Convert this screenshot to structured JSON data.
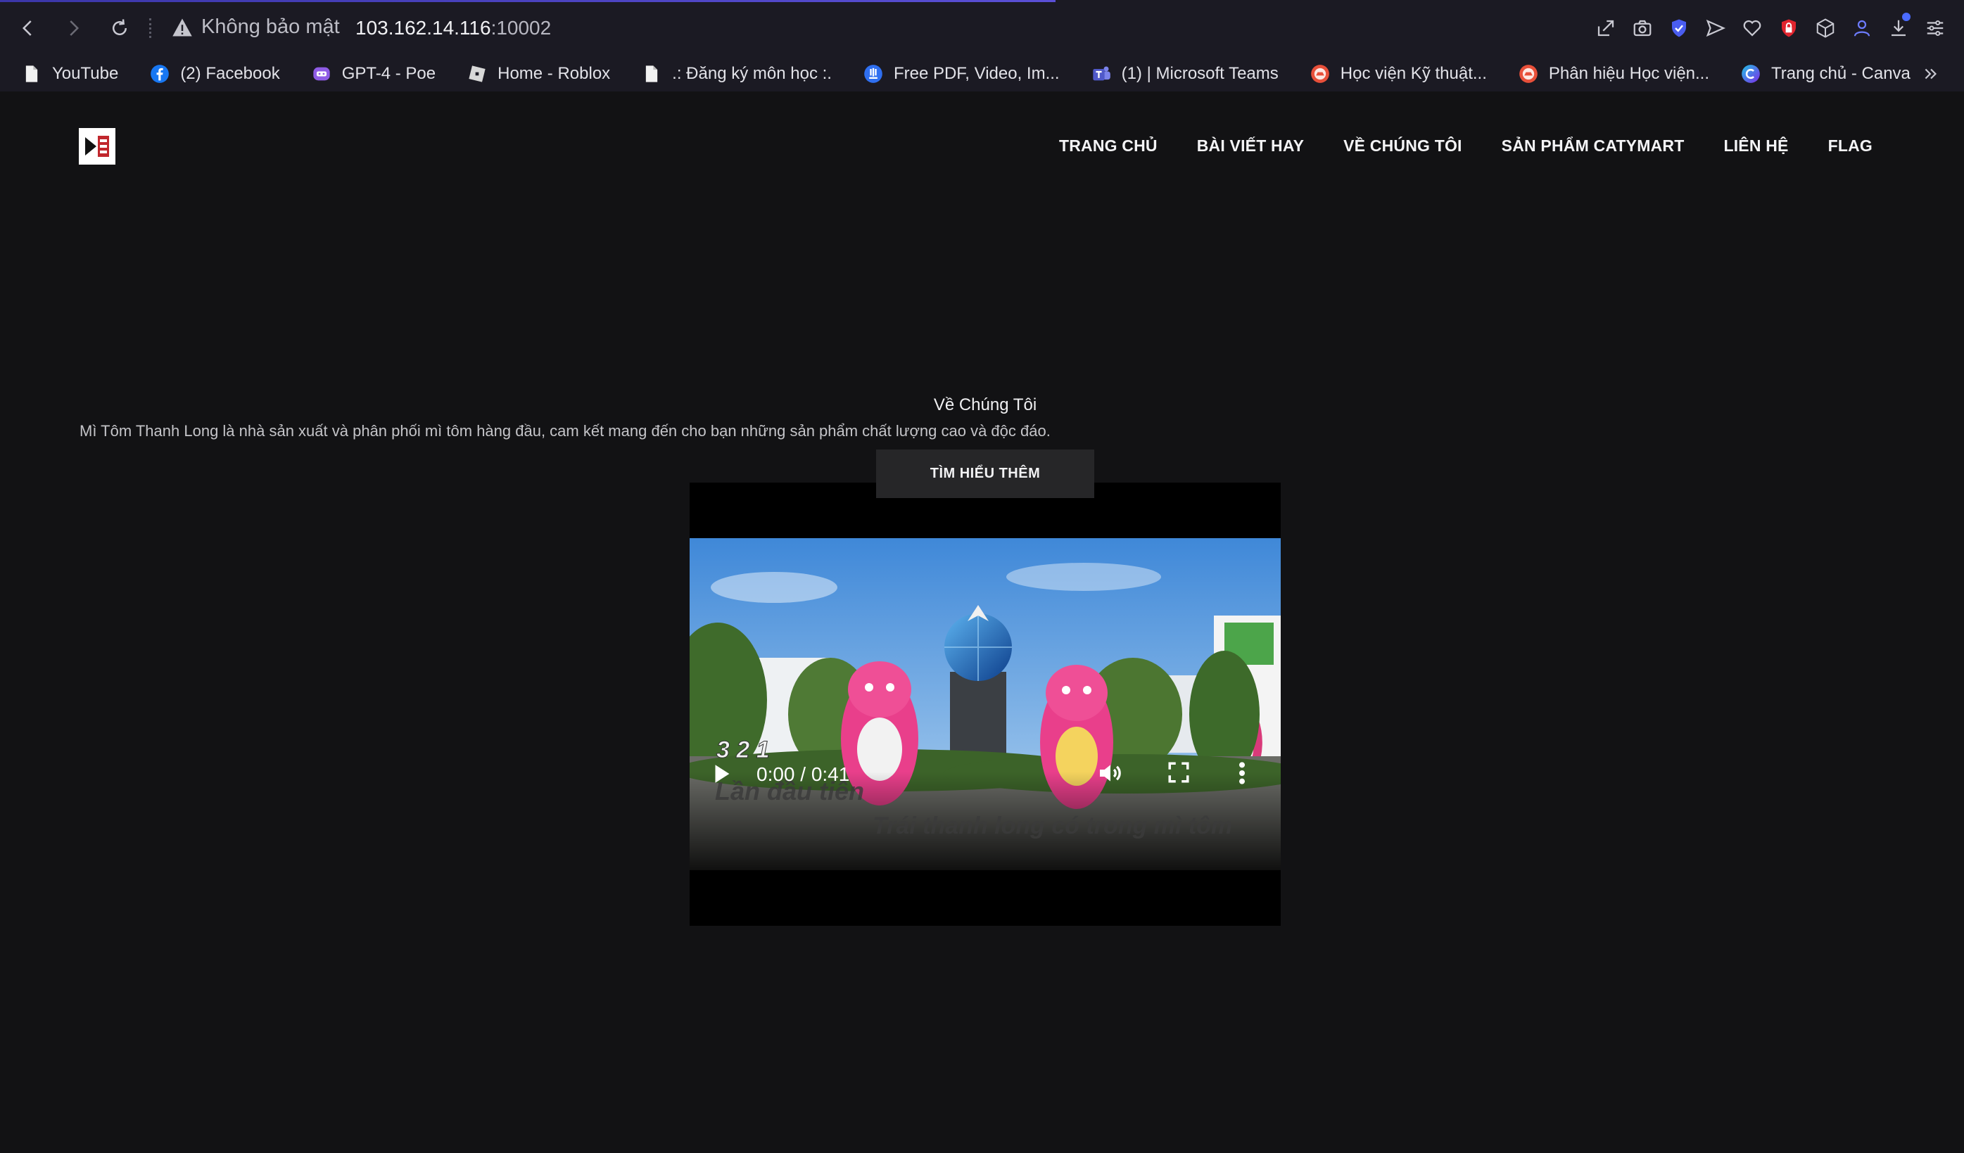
{
  "browser": {
    "security_label": "Không bảo mật",
    "url_host": "103.162.14.116",
    "url_port": ":10002",
    "bookmarks": [
      {
        "label": "YouTube",
        "icon": "page-icon"
      },
      {
        "label": "(2) Facebook",
        "icon": "facebook-icon"
      },
      {
        "label": "GPT-4 - Poe",
        "icon": "poe-icon"
      },
      {
        "label": "Home - Roblox",
        "icon": "roblox-icon"
      },
      {
        "label": ".: Đăng ký môn học :.",
        "icon": "page-icon"
      },
      {
        "label": "Free PDF, Video, Im...",
        "icon": "download-site-icon"
      },
      {
        "label": "(1) | Microsoft Teams",
        "icon": "teams-icon"
      },
      {
        "label": "Học viện Kỹ thuật...",
        "icon": "academy-icon"
      },
      {
        "label": "Phân hiệu Học viện...",
        "icon": "academy-icon"
      },
      {
        "label": "Trang chủ - Canva",
        "icon": "canva-icon"
      }
    ],
    "colors": {
      "chrome_bg": "#1b1a23",
      "accent": "#4b4be0",
      "shield": "#e0242e"
    }
  },
  "site": {
    "nav": [
      "TRANG CHỦ",
      "BÀI VIẾT HAY",
      "VỀ CHÚNG TÔI",
      "SẢN PHẨM CATYMART",
      "LIÊN HỆ",
      "FLAG"
    ],
    "about_title": "Về Chúng Tôi",
    "about_desc": "Mì Tôm Thanh Long là nhà sản xuất và phân phối mì tôm hàng đầu, cam kết mang đến cho bạn những sản phẩm chất lượng cao và độc đáo.",
    "cta_label": "TÌM HIỂU THÊM",
    "video": {
      "time": "0:00 / 0:41",
      "caption_count": "3 2 1",
      "caption_line1": "Lần đầu tiên",
      "caption_line2": "Trái thanh long có trong mì tôm"
    }
  }
}
